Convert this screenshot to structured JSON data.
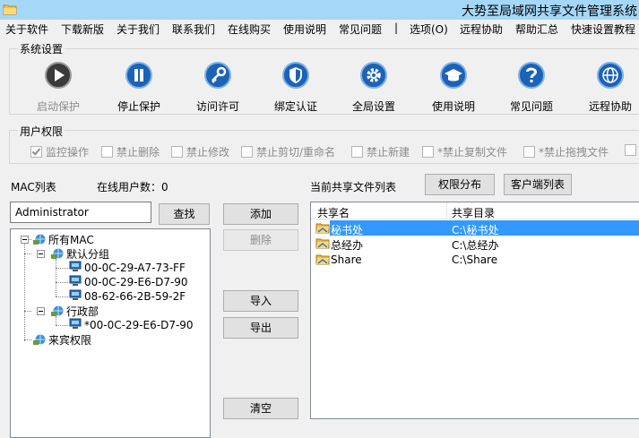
{
  "window": {
    "title": "大势至局域网共享文件管理系统"
  },
  "menu": [
    "关于软件",
    "下载新版",
    "关于我们",
    "联系我们",
    "在线购买",
    "使用说明",
    "常见问题",
    "|",
    "选项(O)",
    "远程协助",
    "帮助汇总",
    "快速设置教程"
  ],
  "system_settings": {
    "label": "系统设置",
    "buttons": [
      {
        "label": "启动保护",
        "icon": "play-icon",
        "enabled": false
      },
      {
        "label": "停止保护",
        "icon": "pause-icon",
        "enabled": true
      },
      {
        "label": "访问许可",
        "icon": "key-icon",
        "enabled": true
      },
      {
        "label": "绑定认证",
        "icon": "shield-icon",
        "enabled": true
      },
      {
        "label": "全局设置",
        "icon": "gear-icon",
        "enabled": true
      },
      {
        "label": "使用说明",
        "icon": "graduation-cap-icon",
        "enabled": true
      },
      {
        "label": "常见问题",
        "icon": "question-icon",
        "enabled": true
      },
      {
        "label": "远程协助",
        "icon": "globe-icon",
        "enabled": true
      }
    ]
  },
  "user_permissions": {
    "label": "用户权限",
    "options": [
      {
        "label": "监控操作",
        "checked": true
      },
      {
        "label": "禁止删除",
        "checked": false
      },
      {
        "label": "禁止修改",
        "checked": false
      },
      {
        "label": "禁止剪切/重命名",
        "checked": false
      },
      {
        "label": "禁止新建",
        "checked": false
      },
      {
        "label": "*禁止复制文件",
        "checked": false
      },
      {
        "label": "*禁止拖拽文件",
        "checked": false
      }
    ]
  },
  "mac_list": {
    "label": "MAC列表",
    "online_users": "在线用户数：0",
    "search_value": "Administrator",
    "search_button": "查找",
    "tree": {
      "root": "所有MAC",
      "default_group": "默认分组",
      "default_items": [
        "00-0C-29-A7-73-FF",
        "00-0C-29-E6-D7-90",
        "08-62-66-2B-59-2F"
      ],
      "admin_group": "行政部",
      "admin_items": [
        "*00-0C-29-E6-D7-90"
      ],
      "guest": "来宾权限"
    }
  },
  "actions": {
    "add": "添加",
    "delete": "删除",
    "import": "导入",
    "export": "导出",
    "clear": "清空"
  },
  "shared_files": {
    "label": "当前共享文件列表",
    "permission_button": "权限分布",
    "client_button": "客户端列表",
    "columns": [
      "共享名",
      "共享目录"
    ],
    "rows": [
      {
        "name": "秘书处",
        "path": "C:\\秘书处",
        "selected": true
      },
      {
        "name": "总经办",
        "path": "C:\\总经办",
        "selected": false
      },
      {
        "name": "Share",
        "path": "C:\\Share",
        "selected": false
      }
    ]
  },
  "colors": {
    "titlebar": "#a5d8f8",
    "selection": "#3399ff",
    "icon_blue": "#1c62b5"
  }
}
